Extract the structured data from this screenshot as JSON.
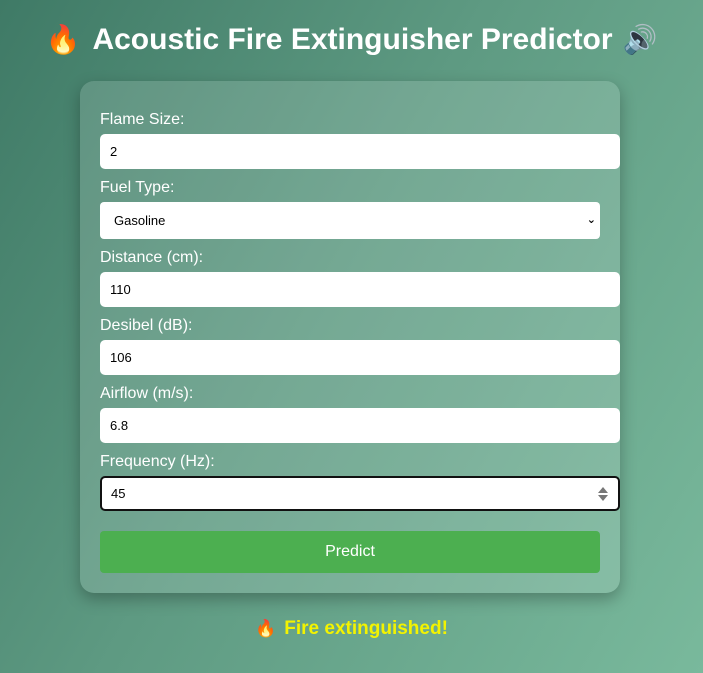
{
  "header": {
    "title": "Acoustic Fire Extinguisher Predictor",
    "fire_icon": "🔥",
    "speaker_icon": "🔊"
  },
  "form": {
    "flame_size": {
      "label": "Flame Size:",
      "value": "2"
    },
    "fuel_type": {
      "label": "Fuel Type:",
      "value": "Gasoline"
    },
    "distance": {
      "label": "Distance (cm):",
      "value": "110"
    },
    "decibel": {
      "label": "Desibel (dB):",
      "value": "106"
    },
    "airflow": {
      "label": "Airflow (m/s):",
      "value": "6.8"
    },
    "frequency": {
      "label": "Frequency (Hz):",
      "value": "45"
    },
    "predict_label": "Predict"
  },
  "result": {
    "icon": "🔥",
    "text": "Fire extinguished!"
  },
  "colors": {
    "button": "#4caf50",
    "result_text": "#f3f300"
  }
}
